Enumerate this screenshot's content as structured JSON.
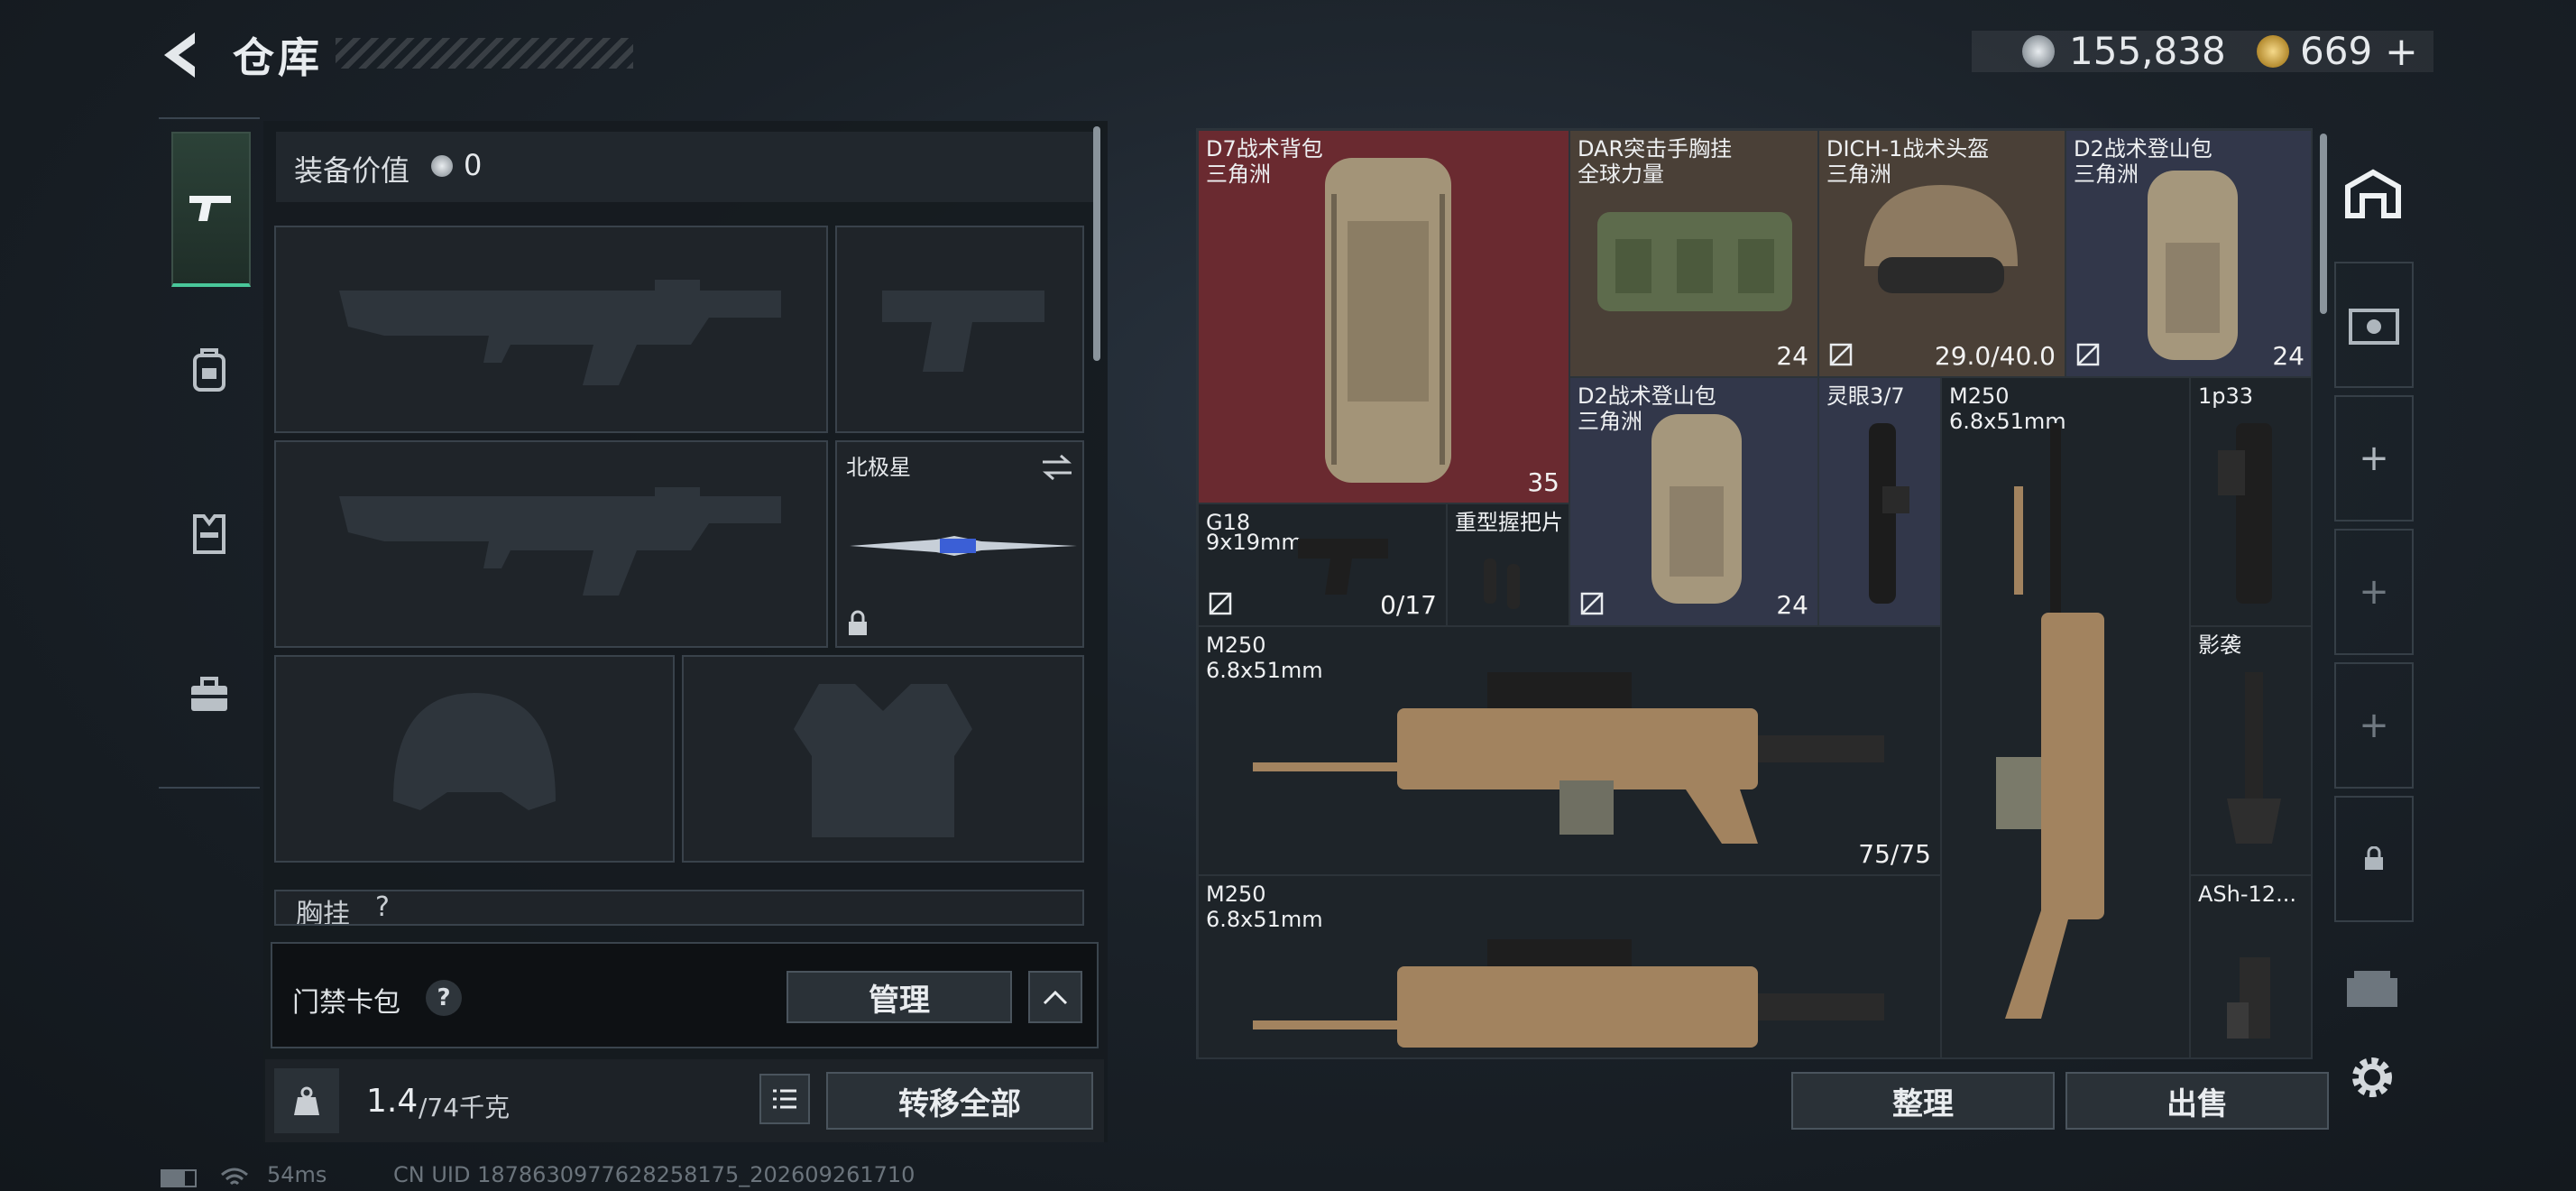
{
  "header": {
    "title": "仓库",
    "silver_amount": "155,838",
    "gold_amount": "669",
    "add_label": "+"
  },
  "left_tabs": [
    "firearm-icon",
    "backpack-icon",
    "armor-vest-icon",
    "toolbox-icon"
  ],
  "loadout": {
    "equipment_value_label": "装备价值",
    "equipment_value": "0",
    "melee_name": "北极星",
    "chest_rig_label": "胸挂",
    "chest_rig_value": "?",
    "keycard_label": "门禁卡包",
    "help_label": "?",
    "manage_label": "管理",
    "weight": "1.4",
    "weight_max": "/74千克",
    "transfer_all_label": "转移全部"
  },
  "stash_items": [
    {
      "name": "D7战术背包",
      "sub": "三角洲",
      "count": "35",
      "rarity": "red"
    },
    {
      "name": "DAR突击手胸挂",
      "sub": "全球力量",
      "count": "24",
      "rarity": "brown"
    },
    {
      "name": "DICH-1战术头盔",
      "sub": "三角洲",
      "count": "29.0/40.0",
      "rarity": "brown"
    },
    {
      "name": "D2战术登山包",
      "sub": "三角洲",
      "count": "24",
      "rarity": "blue"
    },
    {
      "name": "D2战术登山包",
      "sub": "三角洲",
      "count": "24",
      "rarity": "blue"
    },
    {
      "name": "灵眼3/7",
      "sub": "",
      "count": "",
      "rarity": "blue"
    },
    {
      "name": "M250",
      "sub": "6.8x51mm",
      "count": "",
      "rarity": "dark"
    },
    {
      "name": "1p33",
      "sub": "",
      "count": "",
      "rarity": "dark"
    },
    {
      "name": "G18",
      "sub": "9x19mm",
      "count": "0/17",
      "rarity": "dark"
    },
    {
      "name": "重型握把片",
      "sub": "",
      "count": "",
      "rarity": "dark"
    },
    {
      "name": "M250",
      "sub": "6.8x51mm",
      "count": "75/75",
      "rarity": "dark"
    },
    {
      "name": "影袭",
      "sub": "",
      "count": "",
      "rarity": "dark"
    },
    {
      "name": "M250",
      "sub": "6.8x51mm",
      "count": "",
      "rarity": "dark"
    },
    {
      "name": "ASh-12...",
      "sub": "",
      "count": "",
      "rarity": "dark"
    }
  ],
  "actions": {
    "sort_label": "整理",
    "sell_label": "出售"
  },
  "side_rail": {
    "plus": "+"
  },
  "status_bar": {
    "ping": "54ms",
    "uid": "CN UID 1878630977628258175_202609261710"
  },
  "colors": {
    "accent_green": "#49c79a",
    "rarity_red": "#6a2a30",
    "rarity_brown": "#4a4037",
    "rarity_blue": "#32374a"
  }
}
